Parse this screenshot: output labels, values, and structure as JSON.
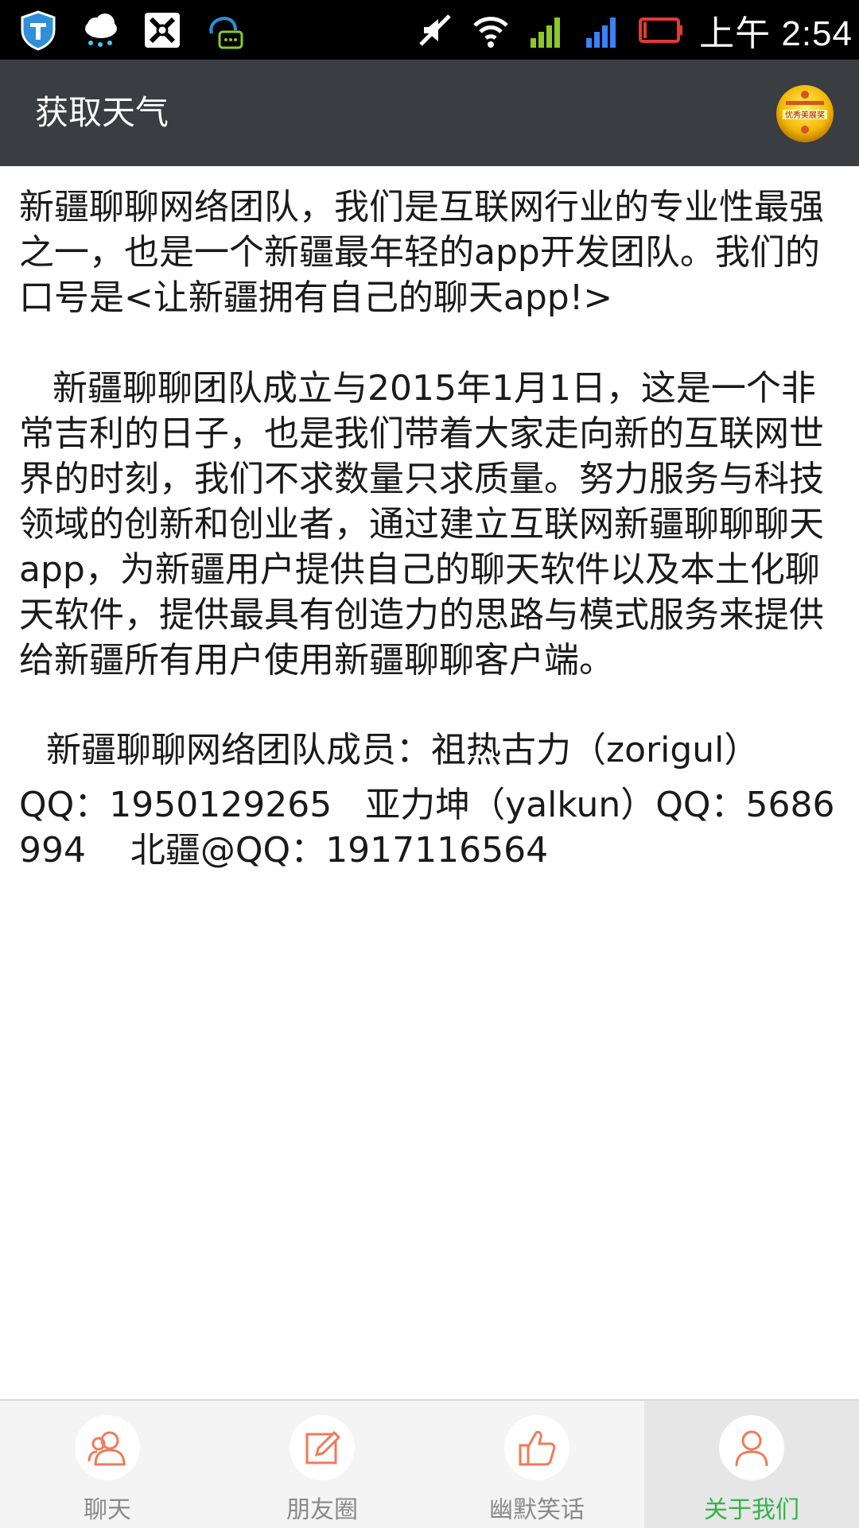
{
  "status_bar": {
    "left_icons": [
      "shield-icon",
      "weather-cloud-icon",
      "app-x-icon",
      "chat-bubble-icon"
    ],
    "right_icons": [
      "mute-icon",
      "wifi-icon",
      "signal-icon",
      "signal-icon",
      "battery-low-icon"
    ],
    "time": "上午 2:54",
    "colors": {
      "signal_green": "#8ac926",
      "signal_blue": "#3b82f6",
      "battery_red": "#e53935"
    }
  },
  "app_bar": {
    "title": "获取天气",
    "badge": {
      "icon": "award-badge-icon",
      "text": "优秀美展奖"
    }
  },
  "content": {
    "intro": "新疆聊聊网络团队，我们是互联网行业的专业性最强之一，也是一个新疆最年轻的app开发团队。我们的口号是<让新疆拥有自己的聊天app!>",
    "history": "   新疆聊聊团队成立与2015年1月1日，这是一个非常吉利的日子，也是我们带着大家走向新的互联网世界的时刻，我们不求数量只求质量。努力服务与科技领域的创新和创业者，通过建立互联网新疆聊聊聊天app，为新疆用户提供自己的聊天软件以及本土化聊天软件，提供最具有创造力的思路与模式服务来提供给新疆所有用户使用新疆聊聊客户端。",
    "members_title": "新疆聊聊网络团队成员：祖热古力（zorigul）",
    "members_info": "QQ：1950129265   亚力坤（yalkun）QQ：5686994    北疆@QQ：1917116564"
  },
  "bottom_nav": {
    "accent": "#f07a5a",
    "active_color": "#36b24a",
    "items": [
      {
        "label": "聊天",
        "icon": "user-group-icon",
        "active": false
      },
      {
        "label": "朋友圈",
        "icon": "edit-icon",
        "active": false
      },
      {
        "label": "幽默笑话",
        "icon": "thumbs-up-icon",
        "active": false
      },
      {
        "label": "关于我们",
        "icon": "user-icon",
        "active": true
      }
    ]
  }
}
